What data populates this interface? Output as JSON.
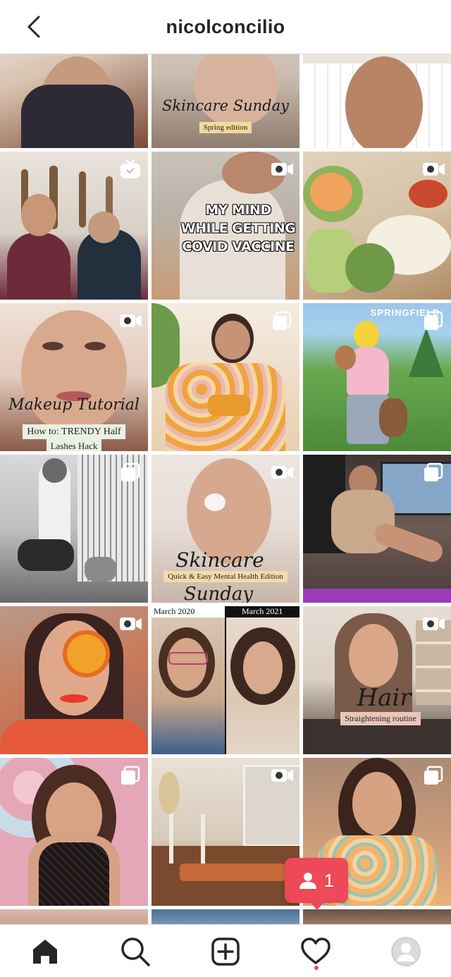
{
  "header": {
    "username": "nicolconcilio",
    "back_icon": "chevron-left-icon"
  },
  "grid": {
    "posts": [
      {
        "id": "r0c0",
        "type": "image",
        "palette": [
          "#d9c2b0",
          "#7a4a36"
        ]
      },
      {
        "id": "r0c1",
        "type": "image",
        "script": "Skincare Sunday",
        "plate": "Spring edition",
        "palette": [
          "#cbbeb1",
          "#8f7c6e"
        ]
      },
      {
        "id": "r0c2",
        "type": "image",
        "palette": [
          "#e8e3dc",
          "#9d7055"
        ]
      },
      {
        "id": "r1c0",
        "type": "igtv",
        "palette": [
          "#d8d0c6",
          "#6c2a3a"
        ]
      },
      {
        "id": "r1c1",
        "type": "video",
        "caption": [
          "MY MIND",
          "WHILE GETTING",
          "COVID VACCINE"
        ],
        "palette": [
          "#b9b3a9",
          "#c89c76"
        ]
      },
      {
        "id": "r1c2",
        "type": "video",
        "palette": [
          "#d6c3a6",
          "#8fb35a"
        ]
      },
      {
        "id": "r2c0",
        "type": "video",
        "script": "Makeup Tutorial",
        "plate": "How to: TRENDY Half",
        "plate2": "Lashes Hack",
        "palette": [
          "#e4cbbd",
          "#8a5a48"
        ]
      },
      {
        "id": "r2c1",
        "type": "carousel",
        "palette": [
          "#efe0cf",
          "#e0a24b"
        ]
      },
      {
        "id": "r2c2",
        "type": "carousel",
        "top_text": "SPRINGFIELD",
        "palette": [
          "#6aa84f",
          "#3d6fb8"
        ]
      },
      {
        "id": "r3c0",
        "type": "carousel",
        "palette": [
          "#bfbfbf",
          "#3b3b3b"
        ]
      },
      {
        "id": "r3c1",
        "type": "video",
        "script": "Skincare",
        "plate": "Quick & Easy Mental Health Edition",
        "script2": "Sunday",
        "palette": [
          "#e6ddd6",
          "#9c8375"
        ]
      },
      {
        "id": "r3c2",
        "type": "carousel",
        "palette": [
          "#6d5a54",
          "#c9a98c"
        ]
      },
      {
        "id": "r4c0",
        "type": "video",
        "palette": [
          "#c97a5a",
          "#e63a2b"
        ]
      },
      {
        "id": "r4c1",
        "type": "image",
        "left_label": "March 2020",
        "right_label": "March 2021",
        "palette": [
          "#caa78a",
          "#3e5f8a"
        ]
      },
      {
        "id": "r4c2",
        "type": "video",
        "script": "Hair",
        "plate": "Straightening routine",
        "palette": [
          "#d9cfc5",
          "#5a4a40"
        ]
      },
      {
        "id": "r5c0",
        "type": "carousel",
        "palette": [
          "#e3a7b8",
          "#2a2020"
        ]
      },
      {
        "id": "r5c1",
        "type": "video",
        "palette": [
          "#d7cab9",
          "#b86a3a"
        ]
      },
      {
        "id": "r5c2",
        "type": "carousel",
        "palette": [
          "#c99a7a",
          "#e6b27b"
        ]
      }
    ]
  },
  "notification": {
    "count": "1",
    "icon": "person-icon",
    "color": "#ed4956"
  },
  "tabbar": {
    "items": [
      {
        "name": "home",
        "icon": "home-icon"
      },
      {
        "name": "search",
        "icon": "search-icon"
      },
      {
        "name": "create",
        "icon": "plus-square-icon"
      },
      {
        "name": "activity",
        "icon": "heart-icon"
      },
      {
        "name": "profile",
        "icon": "avatar-icon"
      }
    ]
  }
}
